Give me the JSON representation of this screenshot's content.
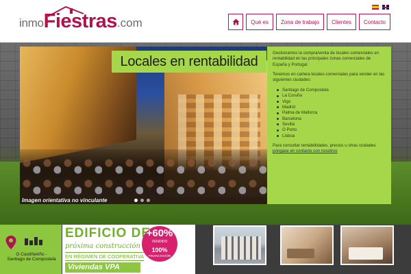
{
  "header": {
    "logo_prefix": "inmo",
    "logo_main": "Fiestras",
    "logo_suffix": ".com",
    "flags": [
      "es-flag",
      "en-flag"
    ],
    "nav": [
      {
        "icon": "home-icon"
      },
      {
        "label": "Qué es"
      },
      {
        "label": "Zona de trabajo"
      },
      {
        "label": "Clientes"
      },
      {
        "label": "Contacto"
      }
    ]
  },
  "hero": {
    "title": "Locales en rentabilidad",
    "caption": "Imagen orientativa no vinculante",
    "slides": 3,
    "active_slide": 1
  },
  "info": {
    "p1": "Gestionamos la compra/venta de locales comerciales en rentabilidad en las principales zonas comerciales de España y Portugal",
    "p2": "Tenemos en cartera locales comerciales para vender en las siguientes ciudades:",
    "cities": [
      "Santiago de Compostela",
      "La Coruña",
      "Vigo",
      "Madrid",
      "Palma de Mallorca",
      "Barcelona",
      "Sevilla",
      "O Porto",
      "Lisboa"
    ],
    "p3": "Para consultar rentabilidades, precios u otras ciudades",
    "link": "póngase en contacto con nosotros"
  },
  "strip": {
    "location": "O Castiñeiriño -\nSantiago de Compostela",
    "promo_l1": "EDIFICIO DE",
    "promo_l2": "próxima construcción",
    "promo_l3": "EN RÉGIMEN DE COOPERATIVA",
    "promo_l4": "Viviendas VPA",
    "badge_pct": "+60%",
    "badge_txt": "VENDIDO",
    "badge_pct2": "100%",
    "badge_txt2": "FINANCIACIÓN"
  },
  "colors": {
    "brand": "#b0124f",
    "accent_green": "#a6d64a",
    "badge_pink": "#d6226e"
  }
}
